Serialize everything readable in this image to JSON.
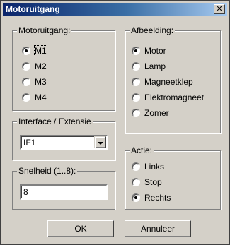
{
  "window": {
    "title": "Motoruitgang",
    "close_glyph": "✕"
  },
  "motor_group": {
    "legend": "Motoruitgang:",
    "options": [
      "M1",
      "M2",
      "M3",
      "M4"
    ],
    "selected": "M1"
  },
  "interface_group": {
    "legend": "Interface / Extensie",
    "selected_value": "IF1"
  },
  "speed_group": {
    "legend": "Snelheid (1..8):",
    "value": "8"
  },
  "image_group": {
    "legend": "Afbeelding:",
    "options": [
      "Motor",
      "Lamp",
      "Magneetklep",
      "Elektromagneet",
      "Zomer"
    ],
    "selected": "Motor"
  },
  "action_group": {
    "legend": "Actie:",
    "options": [
      "Links",
      "Stop",
      "Rechts"
    ],
    "selected": "Rechts"
  },
  "buttons": {
    "ok": "OK",
    "cancel": "Annuleer"
  },
  "colors": {
    "dialog_face": "#d4d0c8",
    "titlebar_start": "#0a246a",
    "titlebar_end": "#a6caf0"
  }
}
